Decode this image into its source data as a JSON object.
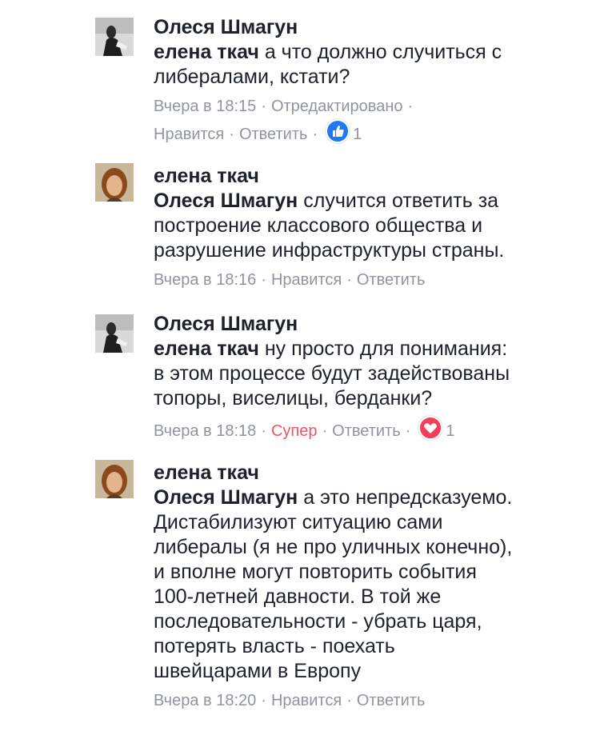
{
  "comments": [
    {
      "author": "Олеся Шмагун",
      "mention": "елена ткач",
      "text_lines": [
        " а что должно случиться с",
        "либералами, кстати?"
      ],
      "meta": {
        "time": "Вчера в 18:15",
        "edited": "Отредактировано",
        "like": "Нравится",
        "reply": "Ответить",
        "reaction_icon": "like-icon",
        "reaction_count": "1"
      }
    },
    {
      "author": "елена ткач",
      "mention": "Олеся Шмагун",
      "text_lines": [
        " случится ответить за",
        "построение классового общества и",
        "разрушение инфраструктуры страны."
      ],
      "meta": {
        "time": "Вчера в 18:16",
        "like": "Нравится",
        "reply": "Ответить"
      }
    },
    {
      "author": "Олеся Шмагун",
      "mention": "елена ткач",
      "text_lines": [
        " ну просто для понимания:",
        "в этом процессе будут задействованы",
        "топоры, виселицы, берданки?"
      ],
      "meta": {
        "time": "Вчера в 18:18",
        "super": "Супер",
        "reply": "Ответить",
        "reaction_icon": "heart-icon",
        "reaction_count": "1"
      }
    },
    {
      "author": "елена ткач",
      "mention": "Олеся Шмагун",
      "text_lines": [
        " а это непредсказуемо.",
        "Дистабилизуют ситуацию сами",
        "либералы (я не про уличных конечно),",
        "и вполне могут повторить события",
        "100-летней давности. В той же",
        "последовательности - убрать царя,",
        "потерять власть - поехать",
        "швейцарами в Европу"
      ],
      "meta": {
        "time": "Вчера в 18:20",
        "like": "Нравится",
        "reply": "Ответить"
      }
    }
  ],
  "colors": {
    "meta_text": "#90949c",
    "super": "#f25268",
    "like_blue": "#2078f4",
    "heart_red": "#f33e58"
  }
}
